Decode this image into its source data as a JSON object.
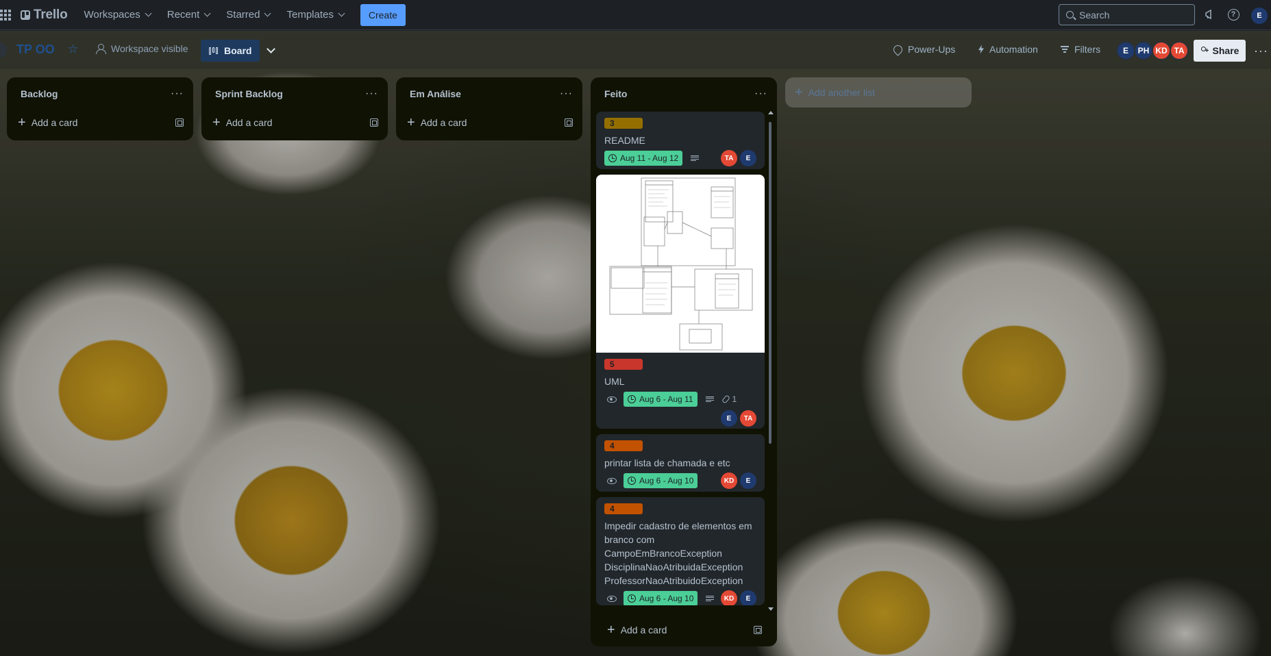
{
  "topnav": {
    "logo": "Trello",
    "items": [
      {
        "label": "Workspaces"
      },
      {
        "label": "Recent"
      },
      {
        "label": "Starred"
      },
      {
        "label": "Templates"
      }
    ],
    "create_label": "Create",
    "search_placeholder": "Search",
    "user_initial": "E"
  },
  "board": {
    "title": "TP OO",
    "visibility": "Workspace visible",
    "view_label": "Board",
    "power_ups": "Power-Ups",
    "automation": "Automation",
    "filters": "Filters",
    "members": [
      {
        "initials": "E",
        "color": "#1f3a6e"
      },
      {
        "initials": "PH",
        "color": "#1f3a6e"
      },
      {
        "initials": "KD",
        "color": "#e34935"
      },
      {
        "initials": "TA",
        "color": "#e34935"
      }
    ],
    "share_label": "Share"
  },
  "lists": [
    {
      "title": "Backlog",
      "add_card": "Add a card"
    },
    {
      "title": "Sprint Backlog",
      "add_card": "Add a card"
    },
    {
      "title": "Em Análise",
      "add_card": "Add a card"
    },
    {
      "title": "Feito",
      "add_card": "Add a card",
      "cards": [
        {
          "label": "3",
          "label_color": "#946f00",
          "title": "README",
          "date": "Aug 11 - Aug 12",
          "members": [
            "TA",
            "E"
          ]
        },
        {
          "label": "5",
          "label_color": "#c9372c",
          "title": "UML",
          "date": "Aug 6 - Aug 11",
          "attachments": "1",
          "members": [
            "E",
            "TA"
          ]
        },
        {
          "label": "4",
          "label_color": "#c25100",
          "title": "printar lista de chamada e etc",
          "date": "Aug 6 - Aug 10",
          "members": [
            "KD",
            "E"
          ]
        },
        {
          "label": "4",
          "label_color": "#c25100",
          "title_lines": [
            "Impedir cadastro de elementos em",
            "branco com",
            "CampoEmBrancoException",
            "DisciplinaNaoAtribuidaException",
            "ProfessorNaoAtribuidoException"
          ],
          "date": "Aug 6 - Aug 10",
          "members": [
            "KD",
            "E"
          ]
        }
      ]
    }
  ],
  "add_list": "Add another list",
  "icons": {
    "apps": "apps-grid-icon",
    "star": "star-icon",
    "visibility": "people-icon",
    "power_ups": "rocket-icon",
    "automation": "bolt-icon",
    "filters": "filter-icon"
  }
}
